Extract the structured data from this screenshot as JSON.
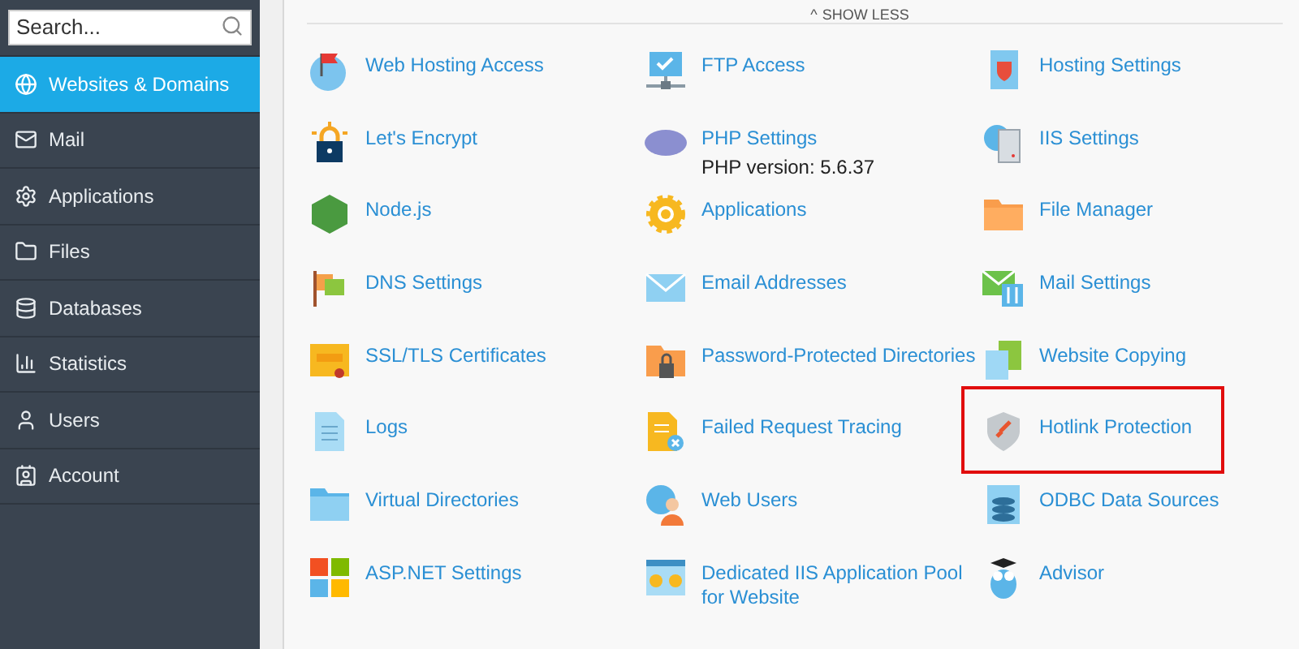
{
  "sidebar": {
    "search": {
      "placeholder": "Search..."
    },
    "items": [
      {
        "label": "Websites & Domains",
        "selected": true
      },
      {
        "label": "Mail",
        "selected": false
      },
      {
        "label": "Applications",
        "selected": false
      },
      {
        "label": "Files",
        "selected": false
      },
      {
        "label": "Databases",
        "selected": false
      },
      {
        "label": "Statistics",
        "selected": false
      },
      {
        "label": "Users",
        "selected": false
      },
      {
        "label": "Account",
        "selected": false
      }
    ]
  },
  "toggle": {
    "caret": "^",
    "label": "SHOW LESS"
  },
  "tools": [
    {
      "label": "Web Hosting Access",
      "highlighted": false
    },
    {
      "label": "FTP Access",
      "highlighted": false
    },
    {
      "label": "Hosting Settings",
      "highlighted": false
    },
    {
      "label": "Let's Encrypt",
      "highlighted": false
    },
    {
      "label": "PHP Settings",
      "subtitle": "PHP version: 5.6.37",
      "highlighted": false
    },
    {
      "label": "IIS Settings",
      "highlighted": false
    },
    {
      "label": "Node.js",
      "highlighted": false
    },
    {
      "label": "Applications",
      "highlighted": false
    },
    {
      "label": "File Manager",
      "highlighted": false
    },
    {
      "label": "DNS Settings",
      "highlighted": false
    },
    {
      "label": "Email Addresses",
      "highlighted": false
    },
    {
      "label": "Mail Settings",
      "highlighted": false
    },
    {
      "label": "SSL/TLS Certificates",
      "highlighted": false
    },
    {
      "label": "Password-Protected Directories",
      "highlighted": false
    },
    {
      "label": "Website Copying",
      "highlighted": false
    },
    {
      "label": "Logs",
      "highlighted": false
    },
    {
      "label": "Failed Request Tracing",
      "highlighted": false
    },
    {
      "label": "Hotlink Protection",
      "highlighted": true
    },
    {
      "label": "Virtual Directories",
      "highlighted": false
    },
    {
      "label": "Web Users",
      "highlighted": false
    },
    {
      "label": "ODBC Data Sources",
      "highlighted": false
    },
    {
      "label": "ASP.NET Settings",
      "highlighted": false
    },
    {
      "label": "Dedicated IIS Application Pool for Website",
      "highlighted": false
    },
    {
      "label": "Advisor",
      "highlighted": false
    }
  ]
}
